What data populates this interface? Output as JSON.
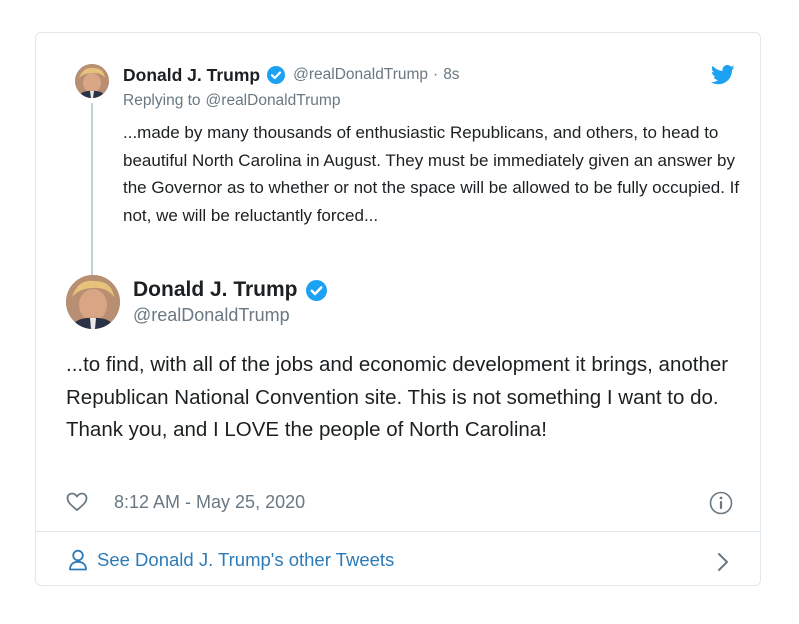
{
  "parent_tweet": {
    "display_name": "Donald J. Trump",
    "handle": "@realDonaldTrump",
    "separator": "·",
    "age": "8s",
    "replying_to_label": "Replying to",
    "replying_to_handle": "@realDonaldTrump",
    "text": "...made by many thousands of enthusiastic Republicans, and others, to head to beautiful North Carolina in August. They must be immediately given an answer by the Governor as to whether or not the space will be allowed to be fully occupied. If not, we will be reluctantly forced..."
  },
  "main_tweet": {
    "display_name": "Donald J. Trump",
    "handle": "@realDonaldTrump",
    "text": "...to find, with all of the jobs and economic development it brings, another Republican National Convention site. This is not something I want to do. Thank you, and I LOVE the people of North Carolina!",
    "timestamp": "8:12 AM - May 25, 2020"
  },
  "footer": {
    "see_more_label": "See Donald J. Trump's other Tweets"
  },
  "icons": {
    "bird": "twitter-bird-icon",
    "verified": "verified-badge-icon",
    "like": "heart-icon",
    "info": "info-icon",
    "person": "person-icon",
    "chevron": "chevron-right-icon"
  },
  "colors": {
    "brand_blue": "#1da1f2",
    "link_blue": "#2b7bb9",
    "muted_text": "#697882",
    "border": "#e1e8ed"
  }
}
